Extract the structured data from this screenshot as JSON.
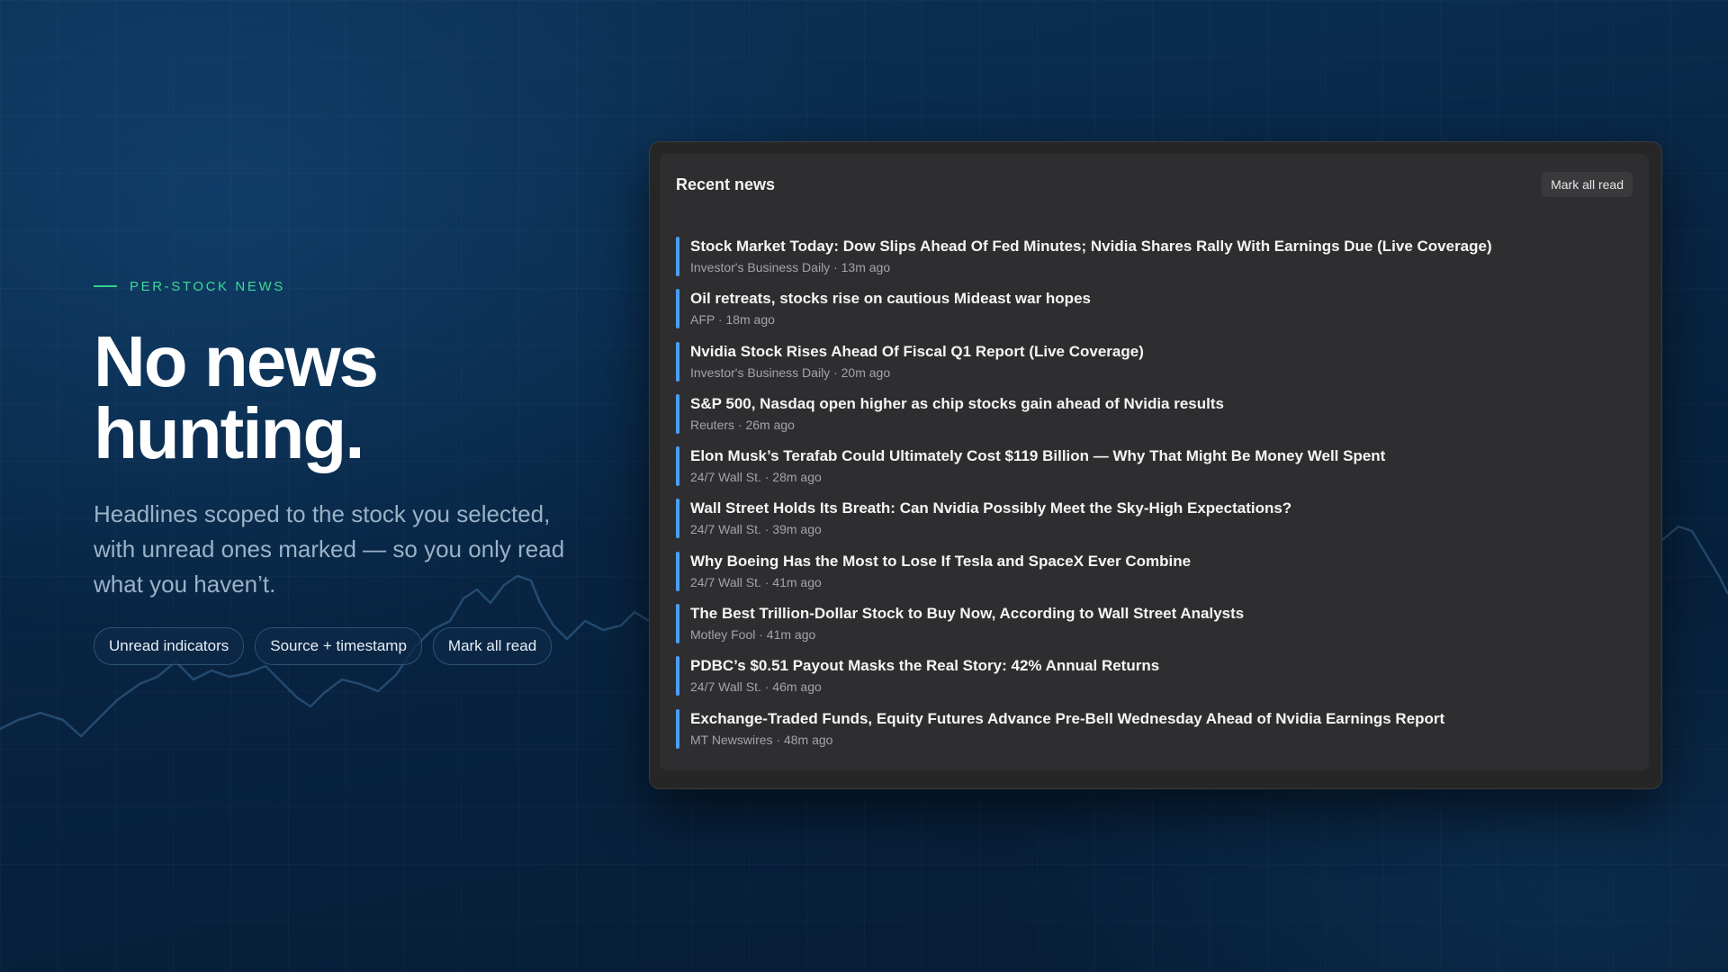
{
  "hero": {
    "eyebrow": "PER-STOCK NEWS",
    "headline": "No news hunting.",
    "subtext": "Headlines scoped to the stock you selected, with unread ones marked — so you only read what you haven’t.",
    "pills": [
      "Unread indicators",
      "Source + timestamp",
      "Mark all read"
    ]
  },
  "news_panel": {
    "title": "Recent news",
    "mark_all_read_label": "Mark all read",
    "unread_color": "#4a9ff5",
    "items": [
      {
        "title": "Stock Market Today: Dow Slips Ahead Of Fed Minutes; Nvidia Shares Rally With Earnings Due (Live Coverage)",
        "meta": "Investor's Business Daily · 13m ago",
        "unread": true
      },
      {
        "title": "Oil retreats, stocks rise on cautious Mideast war hopes",
        "meta": "AFP · 18m ago",
        "unread": true
      },
      {
        "title": "Nvidia Stock Rises Ahead Of Fiscal Q1 Report (Live Coverage)",
        "meta": "Investor's Business Daily · 20m ago",
        "unread": true
      },
      {
        "title": "S&P 500, Nasdaq open higher as chip stocks gain ahead of Nvidia results",
        "meta": "Reuters · 26m ago",
        "unread": true
      },
      {
        "title": "Elon Musk’s Terafab Could Ultimately Cost $119 Billion — Why That Might Be Money Well Spent",
        "meta": "24/7 Wall St. · 28m ago",
        "unread": true
      },
      {
        "title": "Wall Street Holds Its Breath: Can Nvidia Possibly Meet the Sky-High Expectations?",
        "meta": "24/7 Wall St. · 39m ago",
        "unread": true
      },
      {
        "title": "Why Boeing Has the Most to Lose If Tesla and SpaceX Ever Combine",
        "meta": "24/7 Wall St. · 41m ago",
        "unread": true
      },
      {
        "title": "The Best Trillion-Dollar Stock to Buy Now, According to Wall Street Analysts",
        "meta": "Motley Fool · 41m ago",
        "unread": true
      },
      {
        "title": "PDBC’s $0.51 Payout Masks the Real Story: 42% Annual Returns",
        "meta": "24/7 Wall St. · 46m ago",
        "unread": true
      },
      {
        "title": "Exchange-Traded Funds, Equity Futures Advance Pre-Bell Wednesday Ahead of Nvidia Earnings Report",
        "meta": "MT Newswires · 48m ago",
        "unread": true
      }
    ]
  }
}
